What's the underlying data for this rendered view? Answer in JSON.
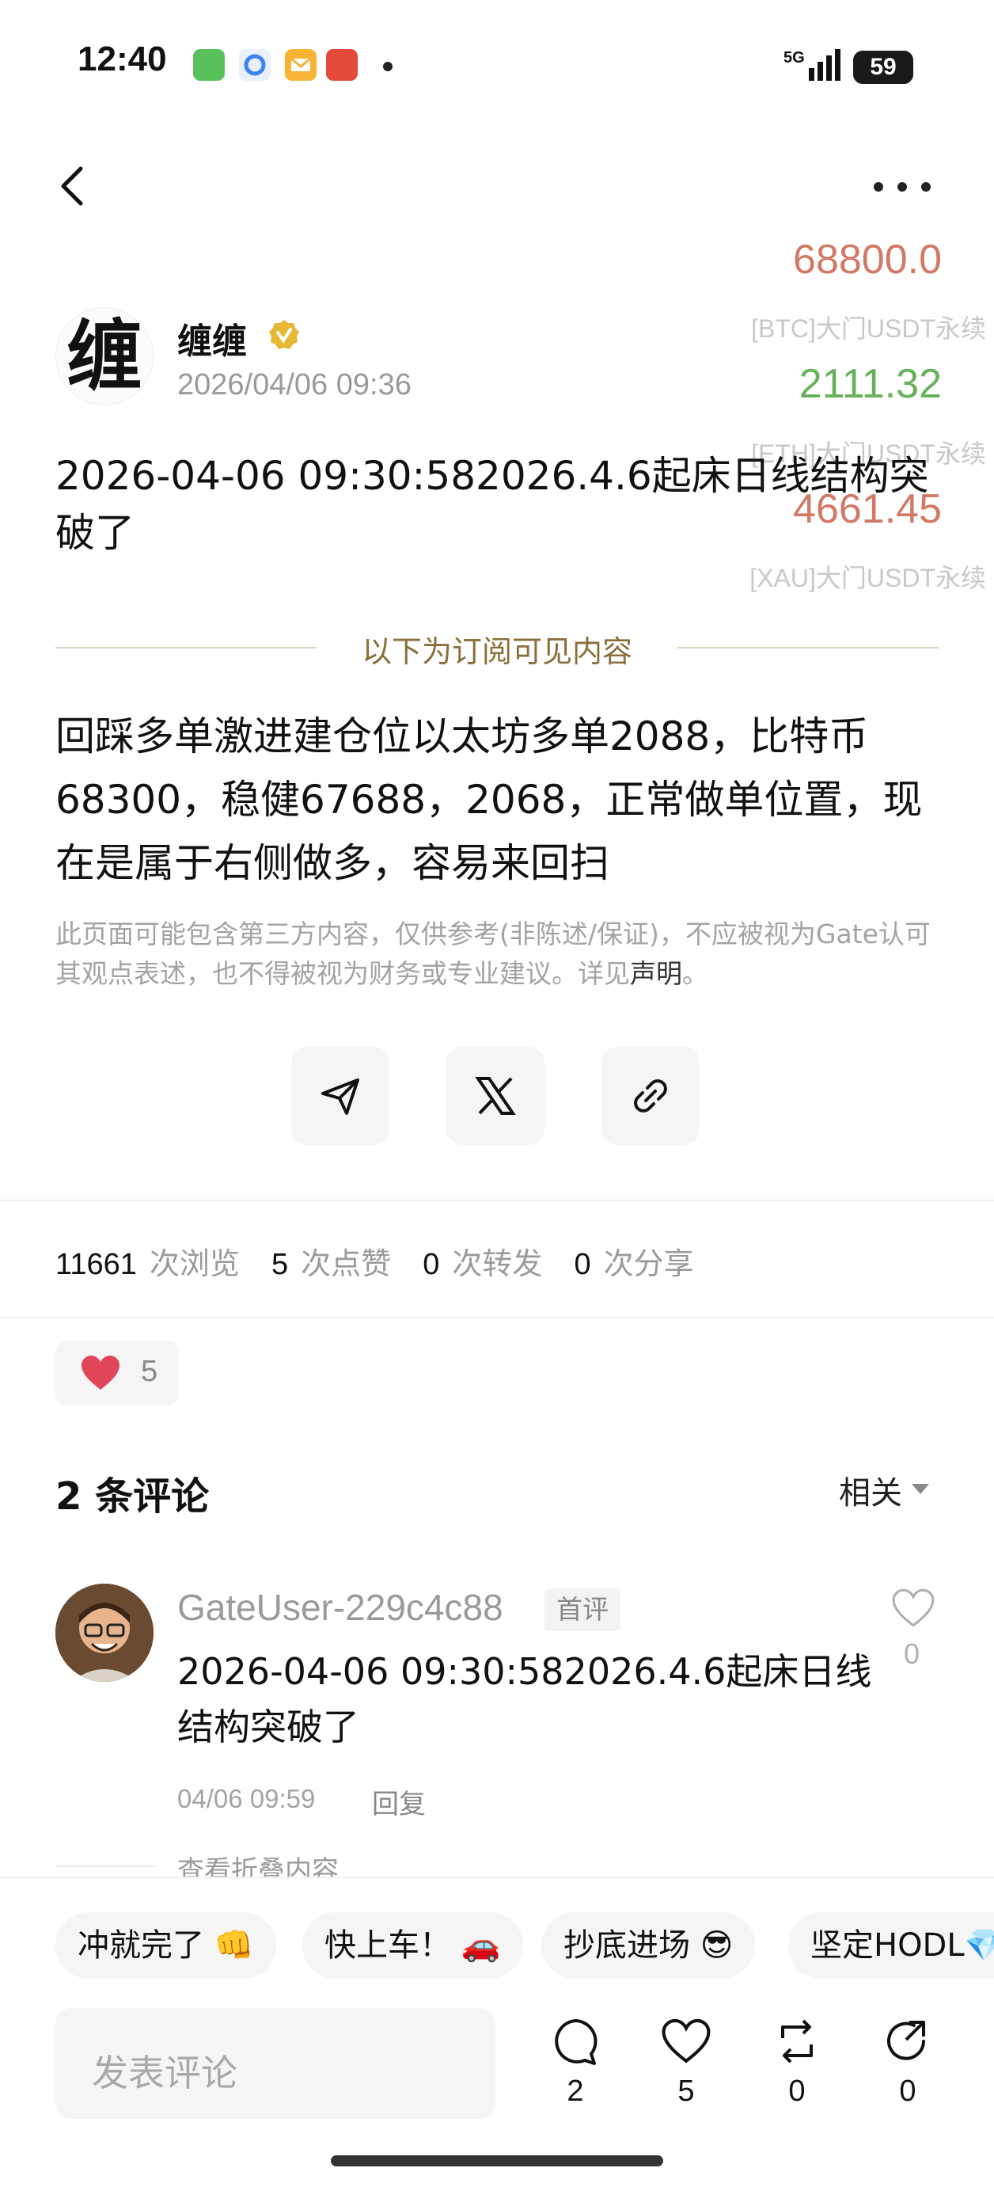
{
  "status_bar": {
    "time": "12:40",
    "network": "5G",
    "battery": "59"
  },
  "ticker": [
    {
      "price": "68800.0",
      "name": "[BTC]大门USDT永续",
      "color": "#d27865"
    },
    {
      "price": "2111.32",
      "name": "[ETH]大门USDT永续",
      "color": "#66b15a"
    },
    {
      "price": "4661.45",
      "name": "[XAU]大门USDT永续",
      "color": "#d27865"
    }
  ],
  "post": {
    "author": "缠缠",
    "author_avatar_glyph": "缠",
    "time": "2026/04/06 09:36",
    "title": "2026-04-06 09:30:582026.4.6起床日线结构突破了",
    "subscriber_label": "以下为订阅可见内容",
    "body": " 回踩多单激进建仓位以太坊多单2088，比特币68300，稳健67688，2068，正常做单位置，现在是属于右侧做多，容易来回扫",
    "disclaimer": "此页面可能包含第三方内容，仅供参考(非陈述/保证)，不应被视为Gate认可其观点表述，也不得被视为财务或专业建议。详见",
    "disclaimer_link": "声明",
    "disclaimer_end": "。"
  },
  "stats": {
    "views": "11661",
    "views_label": "次浏览",
    "likes": "5",
    "likes_label": "次点赞",
    "reposts": "0",
    "reposts_label": "次转发",
    "shares": "0",
    "shares_label": "次分享"
  },
  "reaction": {
    "icon": "heart-icon",
    "count": "5"
  },
  "comments": {
    "title": "2 条评论",
    "sort": "相关",
    "items": [
      {
        "user": "GateUser-229c4c88",
        "badge": "首评",
        "text": "2026-04-06 09:30:582026.4.6起床日线结构突破了",
        "time": "04/06 09:59",
        "reply": "回复",
        "likes": "0"
      }
    ],
    "folded": "查看折叠内容"
  },
  "quick_replies": [
    "冲就完了 👊",
    "快上车！ 🚗",
    "抄底进场 😎",
    "坚定HODL💎"
  ],
  "composer": {
    "placeholder": "发表评论"
  },
  "actions": {
    "comments": "2",
    "likes": "5",
    "reposts": "0",
    "shares": "0"
  }
}
